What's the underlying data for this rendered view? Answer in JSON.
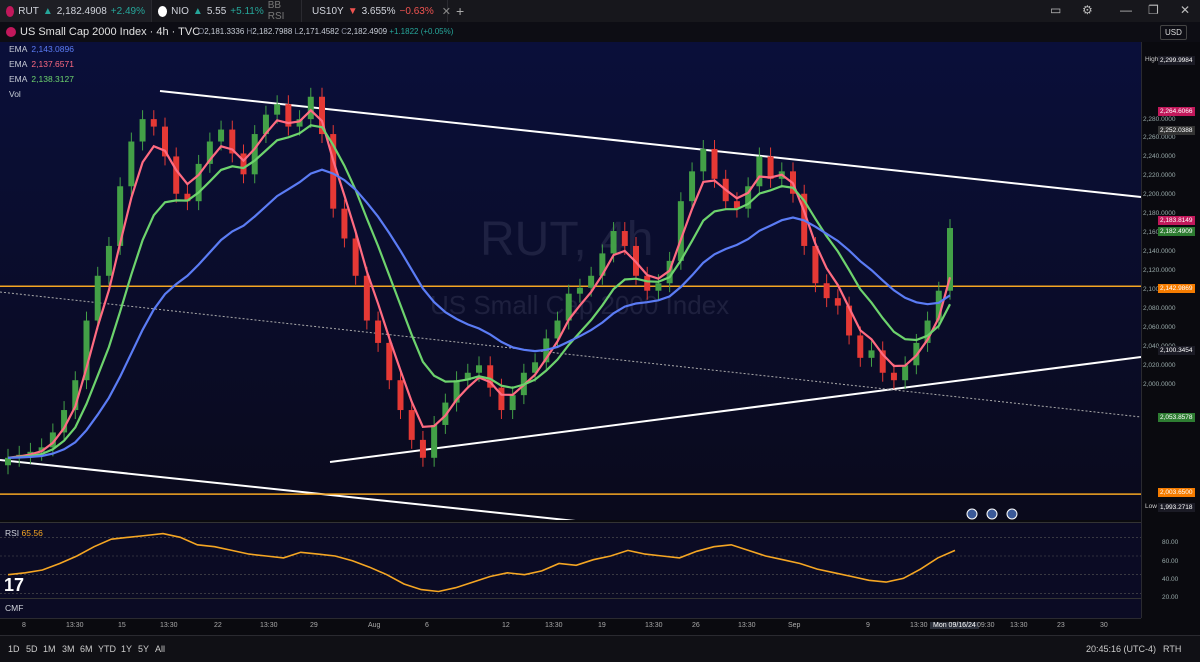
{
  "tabs": [
    {
      "symbol": "RUT",
      "arrow": "▲",
      "price": "2,182.4908",
      "change": "+2.49%",
      "dir": "up"
    },
    {
      "symbol": "NIO",
      "arrow": "▲",
      "price": "5.55",
      "change": "+5.11%",
      "extra": "BB RSI",
      "dir": "up"
    },
    {
      "symbol": "US10Y",
      "arrow": "▼",
      "price": "3.655%",
      "change": "−0.63%",
      "dir": "down"
    }
  ],
  "header": {
    "title": "US Small Cap 2000 Index · 4h · TVC",
    "open": "2,181.3336",
    "high": "2,182.7988",
    "low": "2,171.4582",
    "close": "2,182.4909",
    "chg": "+1.1822 (+0.05%)",
    "currency": "USD"
  },
  "indicators": [
    {
      "name": "EMA",
      "value": "2,143.0896",
      "color": "#5b7cf5"
    },
    {
      "name": "EMA",
      "value": "2,137.6571",
      "color": "#ff6b81"
    },
    {
      "name": "EMA",
      "value": "2,138.3127",
      "color": "#6dd36d"
    },
    {
      "name": "Vol",
      "value": ""
    }
  ],
  "watermark": {
    "main": "RUT, 4h",
    "sub": "US Small Cap 2000 Index"
  },
  "price_axis": {
    "ticks": [
      "2,280.0000",
      "2,260.0000",
      "2,240.0000",
      "2,220.0000",
      "2,200.0000",
      "2,180.0000",
      "2,160.0000",
      "2,140.0000",
      "2,120.0000",
      "2,100.0000",
      "2,080.0000",
      "2,060.0000",
      "2,040.0000",
      "2,020.0000",
      "2,000.0000"
    ],
    "tags": [
      {
        "label": "High",
        "value": "2,299.9984",
        "color": "#1b1b25"
      },
      {
        "label": "",
        "value": "2,264.6066",
        "color": "#c2185b"
      },
      {
        "label": "",
        "value": "2,252.0388",
        "color": "#333"
      },
      {
        "label": "",
        "value": "2,183.8149",
        "color": "#c2185b"
      },
      {
        "label": "",
        "value": "2,182.4909",
        "color": "#2e7d32"
      },
      {
        "label": "",
        "value": "2,142.9869",
        "color": "#f57c00"
      },
      {
        "label": "",
        "value": "2,100.3454",
        "color": "#1b1b25"
      },
      {
        "label": "",
        "value": "2,053.8578",
        "color": "#2e7d32"
      },
      {
        "label": "",
        "value": "2,003.6500",
        "color": "#f57c00"
      },
      {
        "label": "Low",
        "value": "1,993.2718",
        "color": "#1b1b25"
      }
    ]
  },
  "rsi": {
    "label": "RSI",
    "value": "65.56",
    "ticks": [
      "80.00",
      "60.00",
      "40.00",
      "20.00"
    ]
  },
  "cmf": {
    "label": "CMF"
  },
  "time_axis": [
    "8",
    "13:30",
    "15",
    "13:30",
    "22",
    "13:30",
    "29",
    "Aug",
    "6",
    "12",
    "13:30",
    "19",
    "13:30",
    "26",
    "13:30",
    "Sep",
    "9",
    "13:30",
    "Mon 09/16/24",
    "09:30",
    "13:30",
    "23",
    "30"
  ],
  "ranges": [
    "1D",
    "5D",
    "1M",
    "3M",
    "6M",
    "YTD",
    "1Y",
    "5Y",
    "All"
  ],
  "clock": "20:45:16 (UTC-4)",
  "session": "RTH",
  "chart_data": {
    "type": "candlestick",
    "y_range": [
      1993,
      2300
    ],
    "closes": [
      2028,
      2030,
      2032,
      2035,
      2045,
      2060,
      2080,
      2120,
      2150,
      2170,
      2210,
      2240,
      2255,
      2250,
      2230,
      2205,
      2200,
      2225,
      2240,
      2248,
      2232,
      2218,
      2245,
      2258,
      2265,
      2250,
      2255,
      2270,
      2245,
      2195,
      2175,
      2150,
      2120,
      2105,
      2080,
      2060,
      2040,
      2028,
      2050,
      2065,
      2080,
      2085,
      2090,
      2075,
      2060,
      2070,
      2085,
      2092,
      2108,
      2120,
      2138,
      2142,
      2150,
      2165,
      2180,
      2170,
      2150,
      2140,
      2145,
      2160,
      2200,
      2220,
      2235,
      2215,
      2200,
      2195,
      2210,
      2230,
      2215,
      2220,
      2205,
      2170,
      2145,
      2135,
      2130,
      2110,
      2095,
      2100,
      2085,
      2080,
      2090,
      2105,
      2120,
      2140,
      2182
    ],
    "ema_fast_end": 2137.6571,
    "ema_mid_end": 2138.3127,
    "ema_slow_end": 2143.0896,
    "rsi_values": [
      40,
      42,
      45,
      52,
      60,
      70,
      78,
      80,
      82,
      84,
      80,
      72,
      70,
      66,
      62,
      60,
      58,
      64,
      62,
      60,
      55,
      48,
      40,
      30,
      24,
      22,
      26,
      32,
      38,
      42,
      40,
      44,
      52,
      50,
      56,
      60,
      66,
      62,
      60,
      58,
      65,
      70,
      72,
      66,
      60,
      56,
      52,
      46,
      42,
      38,
      34,
      32,
      36,
      46,
      58,
      66
    ]
  }
}
